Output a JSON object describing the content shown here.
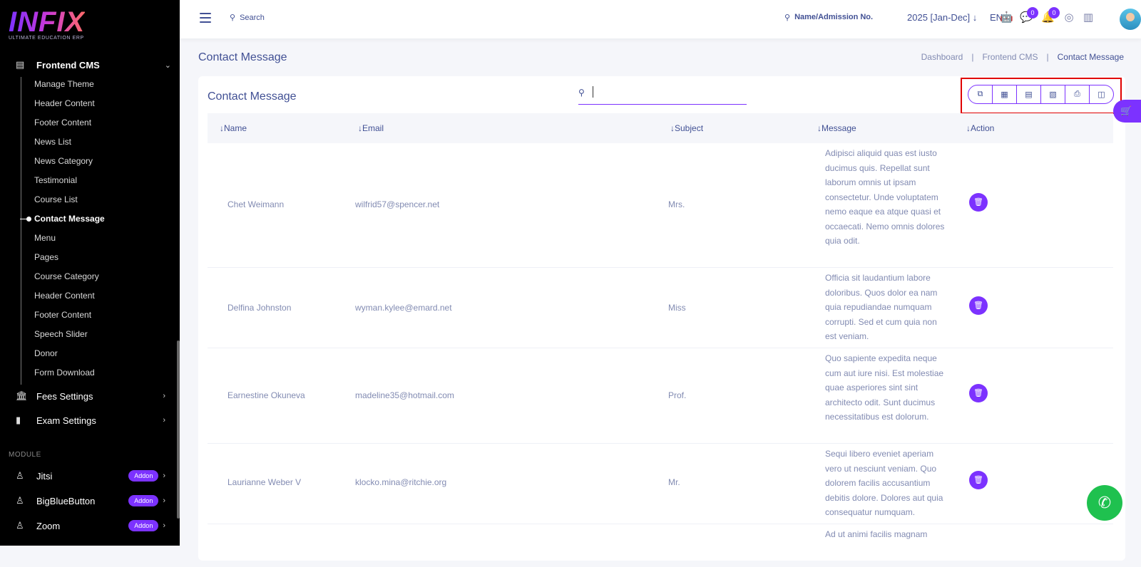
{
  "logo": {
    "brand": "INFIX",
    "tagline": "ULTIMATE EDUCATION ERP"
  },
  "sidebar": {
    "group_label": "Frontend CMS",
    "items": [
      "Manage Theme",
      "Header Content",
      "Footer Content",
      "News List",
      "News Category",
      "Testimonial",
      "Course List",
      "Contact Message",
      "Menu",
      "Pages",
      "Course Category",
      "Header Content",
      "Footer Content",
      "Speech Slider",
      "Donor",
      "Form Download"
    ],
    "active_item": "Contact Message",
    "fees_settings": "Fees Settings",
    "exam_settings": "Exam Settings",
    "module_title": "MODULE",
    "modules": [
      {
        "label": "Jitsi",
        "badge": "Addon"
      },
      {
        "label": "BigBlueButton",
        "badge": "Addon"
      },
      {
        "label": "Zoom",
        "badge": "Addon"
      }
    ]
  },
  "topbar": {
    "search_label": "Search",
    "name_search_label": "Name/Admission No.",
    "year": "2025 [Jan-Dec]",
    "language": "EN",
    "message_count": "0",
    "notification_count": "0"
  },
  "page": {
    "title": "Contact Message",
    "breadcrumb": [
      "Dashboard",
      "Frontend CMS",
      "Contact Message"
    ]
  },
  "table": {
    "title": "Contact Message",
    "headers": [
      "Name",
      "Email",
      "Subject",
      "Message",
      "Action"
    ],
    "rows": [
      {
        "name": "Chet Weimann",
        "email": "wilfrid57@spencer.net",
        "subject": "Mrs.",
        "message": "Adipisci aliquid quas est iusto ducimus quis. Repellat sunt laborum omnis ut ipsam consectetur. Unde voluptatem nemo eaque ea atque quasi et occaecati. Nemo omnis dolores quia odit."
      },
      {
        "name": "Delfina Johnston",
        "email": "wyman.kylee@emard.net",
        "subject": "Miss",
        "message": "Officia sit laudantium labore doloribus. Quos dolor ea nam quia repudiandae numquam corrupti. Sed et cum quia non est veniam."
      },
      {
        "name": "Earnestine Okuneva",
        "email": "madeline35@hotmail.com",
        "subject": "Prof.",
        "message": "Quo sapiente expedita neque cum aut iure nisi. Est molestiae quae asperiores sint sint architecto odit. Sunt ducimus necessitatibus est dolorum."
      },
      {
        "name": "Laurianne Weber V",
        "email": "klocko.mina@ritchie.org",
        "subject": "Mr.",
        "message": "Sequi libero eveniet aperiam vero ut nesciunt veniam. Quo dolorem facilis accusantium debitis dolore. Dolores aut quia consequatur numquam."
      },
      {
        "name": "",
        "email": "",
        "subject": "",
        "message": "Ad ut animi facilis magnam"
      }
    ]
  },
  "colors": {
    "accent": "#7c32ff",
    "text": "#415094",
    "muted": "#828bb2",
    "highlight": "#e00000",
    "whatsapp": "#1fc14f"
  }
}
